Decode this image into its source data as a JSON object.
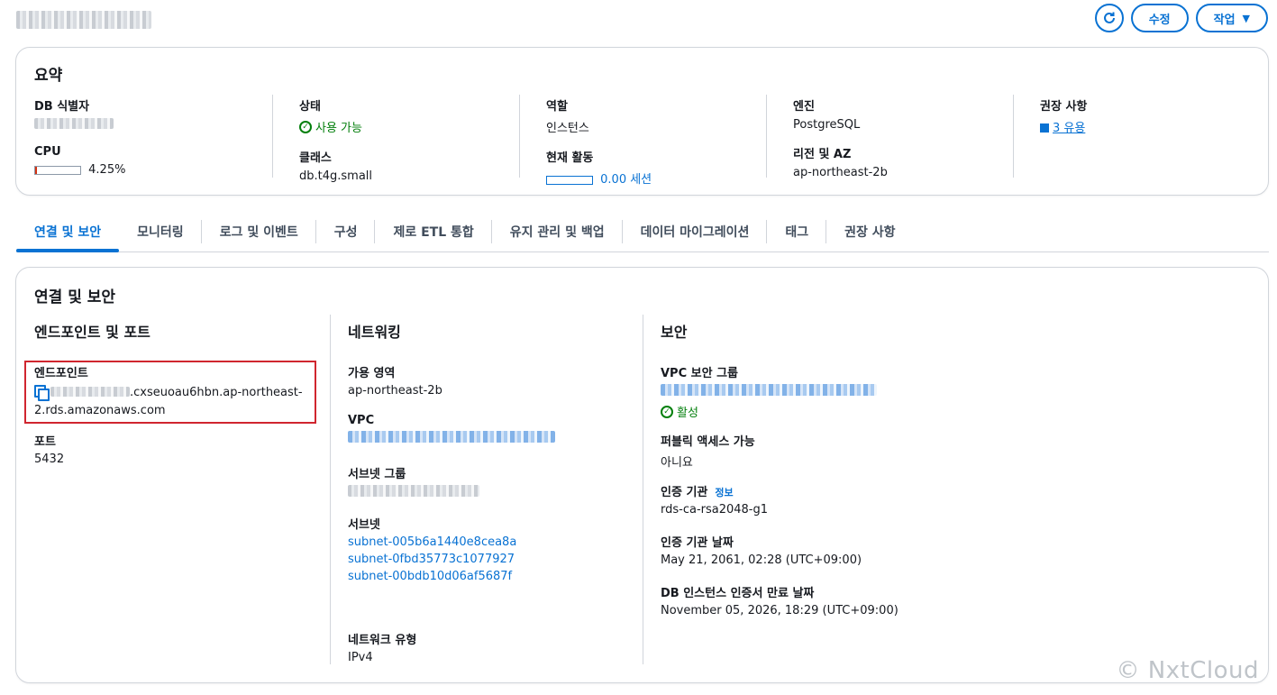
{
  "header": {
    "refresh_icon": "refresh-icon",
    "modify_label": "수정",
    "actions_label": "작업",
    "actions_caret": "▼"
  },
  "summary": {
    "title": "요약",
    "db_identifier_label": "DB 식별자",
    "cpu_label": "CPU",
    "cpu_value": "4.25%",
    "cpu_percent": 4.25,
    "status_label": "상태",
    "status_value": "사용 가능",
    "class_label": "클래스",
    "class_value": "db.t4g.small",
    "role_label": "역할",
    "role_value": "인스턴스",
    "activity_label": "현재 활동",
    "activity_value": "0.00 세션",
    "activity_fraction": 0,
    "engine_label": "엔진",
    "engine_value": "PostgreSQL",
    "region_label": "리전 및 AZ",
    "region_value": "ap-northeast-2b",
    "recommendations_label": "권장 사항",
    "recommendations_value": "3 유용"
  },
  "tabs": [
    {
      "label": "연결 및 보안",
      "active": true
    },
    {
      "label": "모니터링"
    },
    {
      "label": "로그 및 이벤트"
    },
    {
      "label": "구성"
    },
    {
      "label": "제로 ETL 통합"
    },
    {
      "label": "유지 관리 및 백업"
    },
    {
      "label": "데이터 마이그레이션"
    },
    {
      "label": "태그"
    },
    {
      "label": "권장 사항"
    }
  ],
  "connectivity": {
    "title": "연결 및 보안",
    "endpoints": {
      "title": "엔드포인트 및 포트",
      "endpoint_label": "엔드포인트",
      "endpoint_value_visible": ".cxseuoau6hbn.ap-northeast-",
      "endpoint_value_line2": "2.rds.amazonaws.com",
      "port_label": "포트",
      "port_value": "5432"
    },
    "networking": {
      "title": "네트워킹",
      "az_label": "가용 영역",
      "az_value": "ap-northeast-2b",
      "vpc_label": "VPC",
      "subnet_group_label": "서브넷 그룹",
      "subnets_label": "서브넷",
      "subnets": [
        "subnet-005b6a1440e8cea8a",
        "subnet-0fbd35773c1077927",
        "subnet-00bdb10d06af5687f"
      ],
      "network_type_label": "네트워크 유형",
      "network_type_value": "IPv4"
    },
    "security": {
      "title": "보안",
      "vpc_sg_label": "VPC 보안 그룹",
      "vpc_sg_status": "활성",
      "public_label": "퍼블릭 액세스 가능",
      "public_value": "아니요",
      "ca_label": "인증 기관",
      "ca_info": "정보",
      "ca_value": "rds-ca-rsa2048-g1",
      "ca_date_label": "인증 기관 날짜",
      "ca_date_value": "May 21, 2061, 02:28 (UTC+09:00)",
      "cert_expiry_label": "DB 인스턴스 인증서 만료 날짜",
      "cert_expiry_value": "November 05, 2026, 18:29 (UTC+09:00)"
    }
  },
  "watermark": "© NxtCloud"
}
